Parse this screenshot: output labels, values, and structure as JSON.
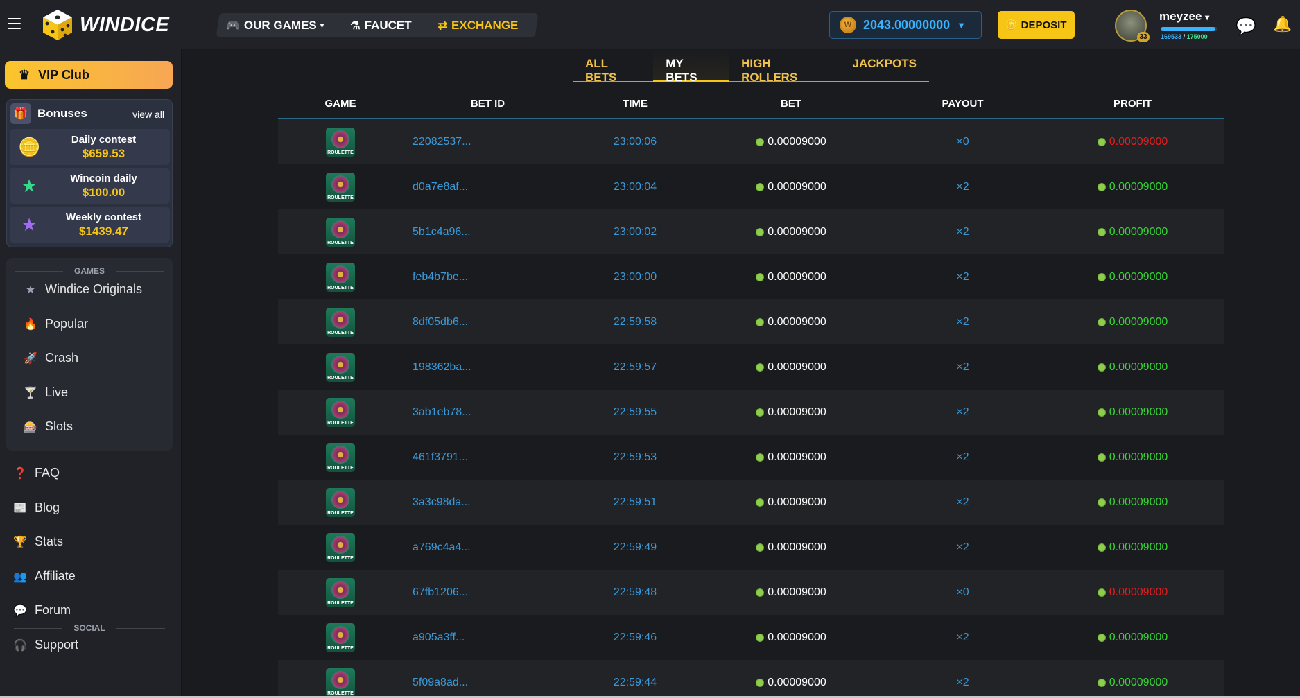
{
  "header": {
    "logo_text": "WINDICE",
    "nav": [
      {
        "label": "OUR GAMES",
        "icon": "gamepad-icon"
      },
      {
        "label": "FAUCET",
        "icon": "flask-icon"
      },
      {
        "label": "EXCHANGE",
        "icon": "exchange-icon"
      }
    ],
    "balance": "2043.00000000",
    "deposit_label": "DEPOSIT",
    "username": "meyzee",
    "level": "33",
    "xp_current": "169533",
    "xp_sep": "/",
    "xp_max": "175000",
    "xp_progress": 0.969
  },
  "sidebar": {
    "vip_label": "VIP Club",
    "bonuses_title": "Bonuses",
    "view_all": "view all",
    "bonuses": [
      {
        "name": "Daily contest",
        "amount": "$659.53",
        "icon": "coins-icon"
      },
      {
        "name": "Wincoin daily",
        "amount": "$100.00",
        "icon": "star-icon"
      },
      {
        "name": "Weekly contest",
        "amount": "$1439.47",
        "icon": "star-purple-icon"
      }
    ],
    "games_label": "GAMES",
    "games": [
      {
        "label": "Windice Originals",
        "icon": "star-icon"
      },
      {
        "label": "Popular",
        "icon": "fire-icon"
      },
      {
        "label": "Crash",
        "icon": "rocket-icon"
      },
      {
        "label": "Live",
        "icon": "cocktail-icon"
      },
      {
        "label": "Slots",
        "icon": "slots-icon"
      }
    ],
    "links": [
      {
        "label": "FAQ",
        "icon": "question-icon"
      },
      {
        "label": "Blog",
        "icon": "newspaper-icon"
      },
      {
        "label": "Stats",
        "icon": "trophy-icon"
      },
      {
        "label": "Affiliate",
        "icon": "users-icon"
      },
      {
        "label": "Forum",
        "icon": "comments-icon"
      },
      {
        "label": "Support",
        "icon": "headset-icon"
      }
    ],
    "social_label": "SOCIAL"
  },
  "tabs": [
    "ALL BETS",
    "MY BETS",
    "HIGH ROLLERS",
    "JACKPOTS"
  ],
  "active_tab": "MY BETS",
  "table": {
    "headers": [
      "GAME",
      "BET ID",
      "TIME",
      "BET",
      "PAYOUT",
      "PROFIT"
    ],
    "game_label": "ROULETTE",
    "rows": [
      {
        "id": "22082537...",
        "time": "23:00:06",
        "bet": "0.00009000",
        "payout": "×0",
        "profit": "0.00009000",
        "win": false
      },
      {
        "id": "d0a7e8af...",
        "time": "23:00:04",
        "bet": "0.00009000",
        "payout": "×2",
        "profit": "0.00009000",
        "win": true
      },
      {
        "id": "5b1c4a96...",
        "time": "23:00:02",
        "bet": "0.00009000",
        "payout": "×2",
        "profit": "0.00009000",
        "win": true
      },
      {
        "id": "feb4b7be...",
        "time": "23:00:00",
        "bet": "0.00009000",
        "payout": "×2",
        "profit": "0.00009000",
        "win": true
      },
      {
        "id": "8df05db6...",
        "time": "22:59:58",
        "bet": "0.00009000",
        "payout": "×2",
        "profit": "0.00009000",
        "win": true
      },
      {
        "id": "198362ba...",
        "time": "22:59:57",
        "bet": "0.00009000",
        "payout": "×2",
        "profit": "0.00009000",
        "win": true
      },
      {
        "id": "3ab1eb78...",
        "time": "22:59:55",
        "bet": "0.00009000",
        "payout": "×2",
        "profit": "0.00009000",
        "win": true
      },
      {
        "id": "461f3791...",
        "time": "22:59:53",
        "bet": "0.00009000",
        "payout": "×2",
        "profit": "0.00009000",
        "win": true
      },
      {
        "id": "3a3c98da...",
        "time": "22:59:51",
        "bet": "0.00009000",
        "payout": "×2",
        "profit": "0.00009000",
        "win": true
      },
      {
        "id": "a769c4a4...",
        "time": "22:59:49",
        "bet": "0.00009000",
        "payout": "×2",
        "profit": "0.00009000",
        "win": true
      },
      {
        "id": "67fb1206...",
        "time": "22:59:48",
        "bet": "0.00009000",
        "payout": "×0",
        "profit": "0.00009000",
        "win": false
      },
      {
        "id": "a905a3ff...",
        "time": "22:59:46",
        "bet": "0.00009000",
        "payout": "×2",
        "profit": "0.00009000",
        "win": true
      },
      {
        "id": "5f09a8ad...",
        "time": "22:59:44",
        "bet": "0.00009000",
        "payout": "×2",
        "profit": "0.00009000",
        "win": true
      }
    ]
  },
  "colors": {
    "accent": "#f7c515",
    "link_blue": "#3a9ad9",
    "win": "#35d535",
    "loss": "#e21e1e"
  }
}
